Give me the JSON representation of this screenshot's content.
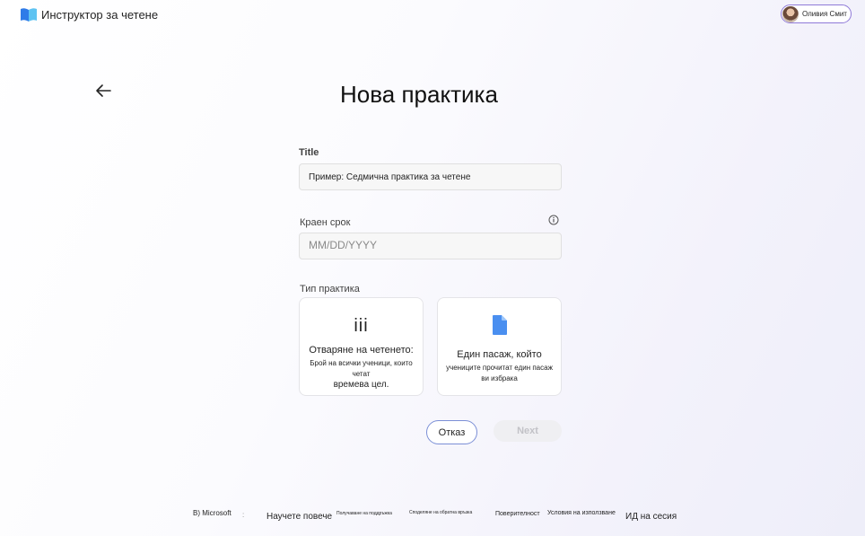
{
  "header": {
    "app_title": "Инструктор за четене",
    "user_name": "Оливия Смит"
  },
  "page": {
    "title": "Нова практика"
  },
  "form": {
    "title_label": "Title",
    "title_placeholder": "Пример: Седмична практика за четене",
    "due_label": "Краен срок",
    "due_placeholder": "MM/DD/YYYY",
    "type_label": "Тип практика",
    "cards": [
      {
        "icon": "iii",
        "icon_name": "bars-icon",
        "title": "Отваряне на четенето:",
        "desc_line1": "Брой на всички ученици, които четат",
        "desc_line2": "времева цел."
      },
      {
        "icon_name": "document-icon",
        "title": "Един пасаж, който",
        "desc_line1": "учениците прочитат един пасаж",
        "desc_line2": "ви избрака"
      }
    ],
    "cancel_label": "Отказ",
    "next_label": "Next"
  },
  "footer": {
    "copyright": "B) Microsoft",
    "separator": ":",
    "learn_more": "Научете повече",
    "support": "Получаване на поддръжка",
    "feedback": "Споделяне на обратна връзка",
    "privacy": "Поверителност",
    "terms": "Условия на използване",
    "session_id": "ИД на сесия"
  },
  "colors": {
    "accent": "#8f7ad8",
    "cancel_border": "#7b8fd6",
    "doc_icon": "#4a8ff0"
  }
}
